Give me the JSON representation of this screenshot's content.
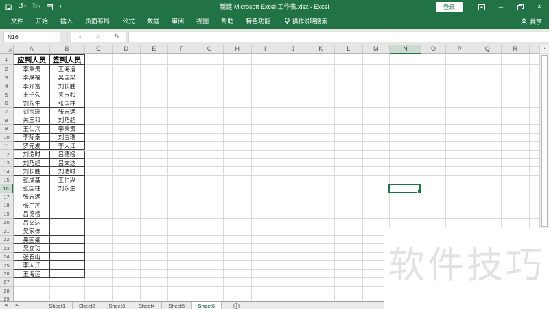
{
  "window": {
    "title": "新建 Microsoft Excel 工作表.xlsx - Excel",
    "sign_in": "登录"
  },
  "icons": {
    "undo": "↺",
    "redo": "↻",
    "caret_down": "▾",
    "minimize": "─",
    "close": "×",
    "formula_cancel": "×",
    "formula_confirm": "✓",
    "formula_function": "fx",
    "dots_separator": "⋮",
    "scroll_up": "▲",
    "tabs_prev": "◀",
    "tabs_next": "▶",
    "add_sheet": "+"
  },
  "ribbon": {
    "tabs": [
      "文件",
      "开始",
      "插入",
      "页面布局",
      "公式",
      "数据",
      "审阅",
      "视图",
      "帮助",
      "特色功能"
    ],
    "tell_me": "操作说明搜索",
    "share": "共享"
  },
  "formula_bar": {
    "name_box": "N16",
    "value": ""
  },
  "sheet": {
    "visible_columns": [
      "A",
      "B",
      "C",
      "D",
      "E",
      "F",
      "G",
      "H",
      "I",
      "J",
      "K",
      "L",
      "M",
      "N",
      "O",
      "P",
      "Q",
      "R"
    ],
    "visible_row_count": 29,
    "selected_cell": "N16",
    "selected_column": "N",
    "selected_row": 16,
    "table": {
      "headers": [
        "应到人员",
        "签到人员"
      ],
      "rows": [
        [
          "李秉贵",
          "王海运"
        ],
        [
          "李厚福",
          "吴国梁"
        ],
        [
          "李开富",
          "刘长胜"
        ],
        [
          "王子久",
          "关玉和"
        ],
        [
          "刘永生",
          "张国柱"
        ],
        [
          "刘宝瑞",
          "张志远"
        ],
        [
          "关玉和",
          "刘乃超"
        ],
        [
          "王仁兴",
          "李秉贵"
        ],
        [
          "李际泰",
          "刘宝瑞"
        ],
        [
          "罗元发",
          "李大江"
        ],
        [
          "刘造时",
          "吕德榜"
        ],
        [
          "刘乃超",
          "吕文达"
        ],
        [
          "刘长胜",
          "刘造时"
        ],
        [
          "张成基",
          "王仁兴"
        ],
        [
          "张国柱",
          "刘永生"
        ],
        [
          "张志远",
          ""
        ],
        [
          "张广才",
          ""
        ],
        [
          "吕德榜",
          ""
        ],
        [
          "吕文达",
          ""
        ],
        [
          "吴家栋",
          ""
        ],
        [
          "吴国梁",
          ""
        ],
        [
          "吴立功",
          ""
        ],
        [
          "张石山",
          ""
        ],
        [
          "李大江",
          ""
        ],
        [
          "王海运",
          ""
        ]
      ]
    }
  },
  "sheet_tabs": {
    "tabs": [
      "Sheet1",
      "Sheet2",
      "Sheet3",
      "Sheet4",
      "Sheet5",
      "Sheet6"
    ],
    "active": "Sheet6"
  },
  "watermark": "软件技巧",
  "colors": {
    "accent_green": "#217346",
    "selection_border": "#217346",
    "header_bg": "#e6e6e6",
    "selected_header_bg": "#cfdbd1",
    "gridline": "#dadada",
    "table_border": "#3c3c3c",
    "watermark_text": "#e2e2e2"
  }
}
